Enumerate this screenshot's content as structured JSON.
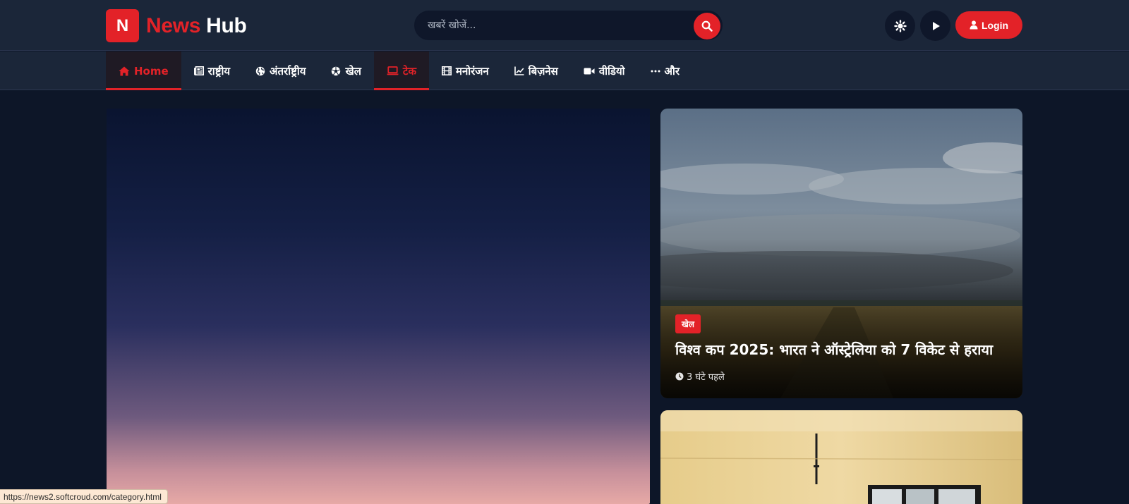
{
  "brand": {
    "letter": "N",
    "name_red": "News",
    "name_white": "Hub"
  },
  "search": {
    "placeholder": "खबरें खोजें..."
  },
  "header": {
    "login_label": "Login"
  },
  "nav": {
    "items": [
      {
        "label": "Home",
        "icon": "home-icon"
      },
      {
        "label": "राष्ट्रीय",
        "icon": "newspaper-icon"
      },
      {
        "label": "अंतर्राष्ट्रीय",
        "icon": "globe-icon"
      },
      {
        "label": "खेल",
        "icon": "football-icon"
      },
      {
        "label": "टेक",
        "icon": "laptop-icon"
      },
      {
        "label": "मनोरंजन",
        "icon": "film-icon"
      },
      {
        "label": "बिज़नेस",
        "icon": "chart-line-icon"
      },
      {
        "label": "वीडियो",
        "icon": "video-icon"
      },
      {
        "label": "और",
        "icon": "more-icon"
      }
    ]
  },
  "featured": [
    {
      "category": "खेल",
      "title": "विश्व कप 2025: भारत ने ऑस्ट्रेलिया को 7 विकेट से हराया",
      "time": "3 घंटे पहले"
    }
  ],
  "status_bar": {
    "url": "https://news2.softcroud.com/category.html"
  },
  "colors": {
    "accent": "#e32228",
    "header_bg": "#1b2639",
    "page_bg": "#0d1628"
  }
}
